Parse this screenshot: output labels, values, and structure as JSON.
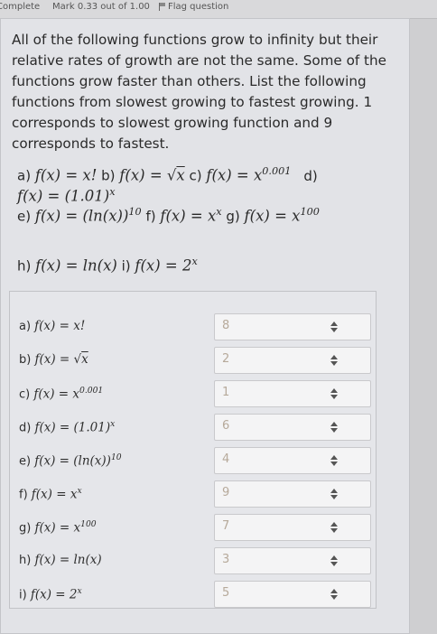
{
  "header": {
    "status": "Complete",
    "mark": "Mark 0.33 out of 1.00",
    "flag_label": "Flag question"
  },
  "question": {
    "text": "All of the following functions grow to infinity but their relative rates of growth are not the same. Some of the functions grow faster than others. List the following functions from slowest growing to fastest growing. 1 corresponds to slowest growing function and 9 corresponds to fastest.",
    "line1": {
      "a_lbl": "a) ",
      "a": "f(x) = x!",
      "b_lbl": " b) ",
      "b_pre": "f(x) = √",
      "b_rad": "x",
      "c_lbl": " c) ",
      "c_base": "f(x) = x",
      "c_exp": "0.001",
      "d_lbl": "d)"
    },
    "line2": {
      "d_base": "f(x) = (1.01)",
      "d_exp": "x"
    },
    "line3": {
      "e_lbl": "e) ",
      "e_base": "f(x) = (ln(x))",
      "e_exp": "10",
      "f_lbl": " f) ",
      "f_base": "f(x) = x",
      "f_exp": "x",
      "g_lbl": " g) ",
      "g_base": "f(x) = x",
      "g_exp": "100"
    },
    "line4": {
      "h_lbl": "h) ",
      "h": "f(x) = ln(x)",
      "i_lbl": " i) ",
      "i_base": "f(x) = 2",
      "i_exp": "x"
    }
  },
  "answers": [
    {
      "label": "a) ",
      "base": "f(x) = x!",
      "exp": "",
      "selected": "8"
    },
    {
      "label": "b) ",
      "base": "f(x) = √",
      "rad": "x",
      "exp": "",
      "selected": "2"
    },
    {
      "label": "c) ",
      "base": "f(x) = x",
      "exp": "0.001",
      "selected": "1"
    },
    {
      "label": "d) ",
      "base": "f(x) = (1.01)",
      "exp": "x",
      "selected": "6"
    },
    {
      "label": "e) ",
      "base": "f(x) = (ln(x))",
      "exp": "10",
      "selected": "4"
    },
    {
      "label": "f) ",
      "base": "f(x) = x",
      "exp": "x",
      "selected": "9"
    },
    {
      "label": "g) ",
      "base": "f(x) = x",
      "exp": "100",
      "selected": "7"
    },
    {
      "label": "h) ",
      "base": "f(x) = ln(x)",
      "exp": "",
      "selected": "3"
    },
    {
      "label": "i) ",
      "base": "f(x) = 2",
      "exp": "x",
      "selected": "5"
    }
  ]
}
